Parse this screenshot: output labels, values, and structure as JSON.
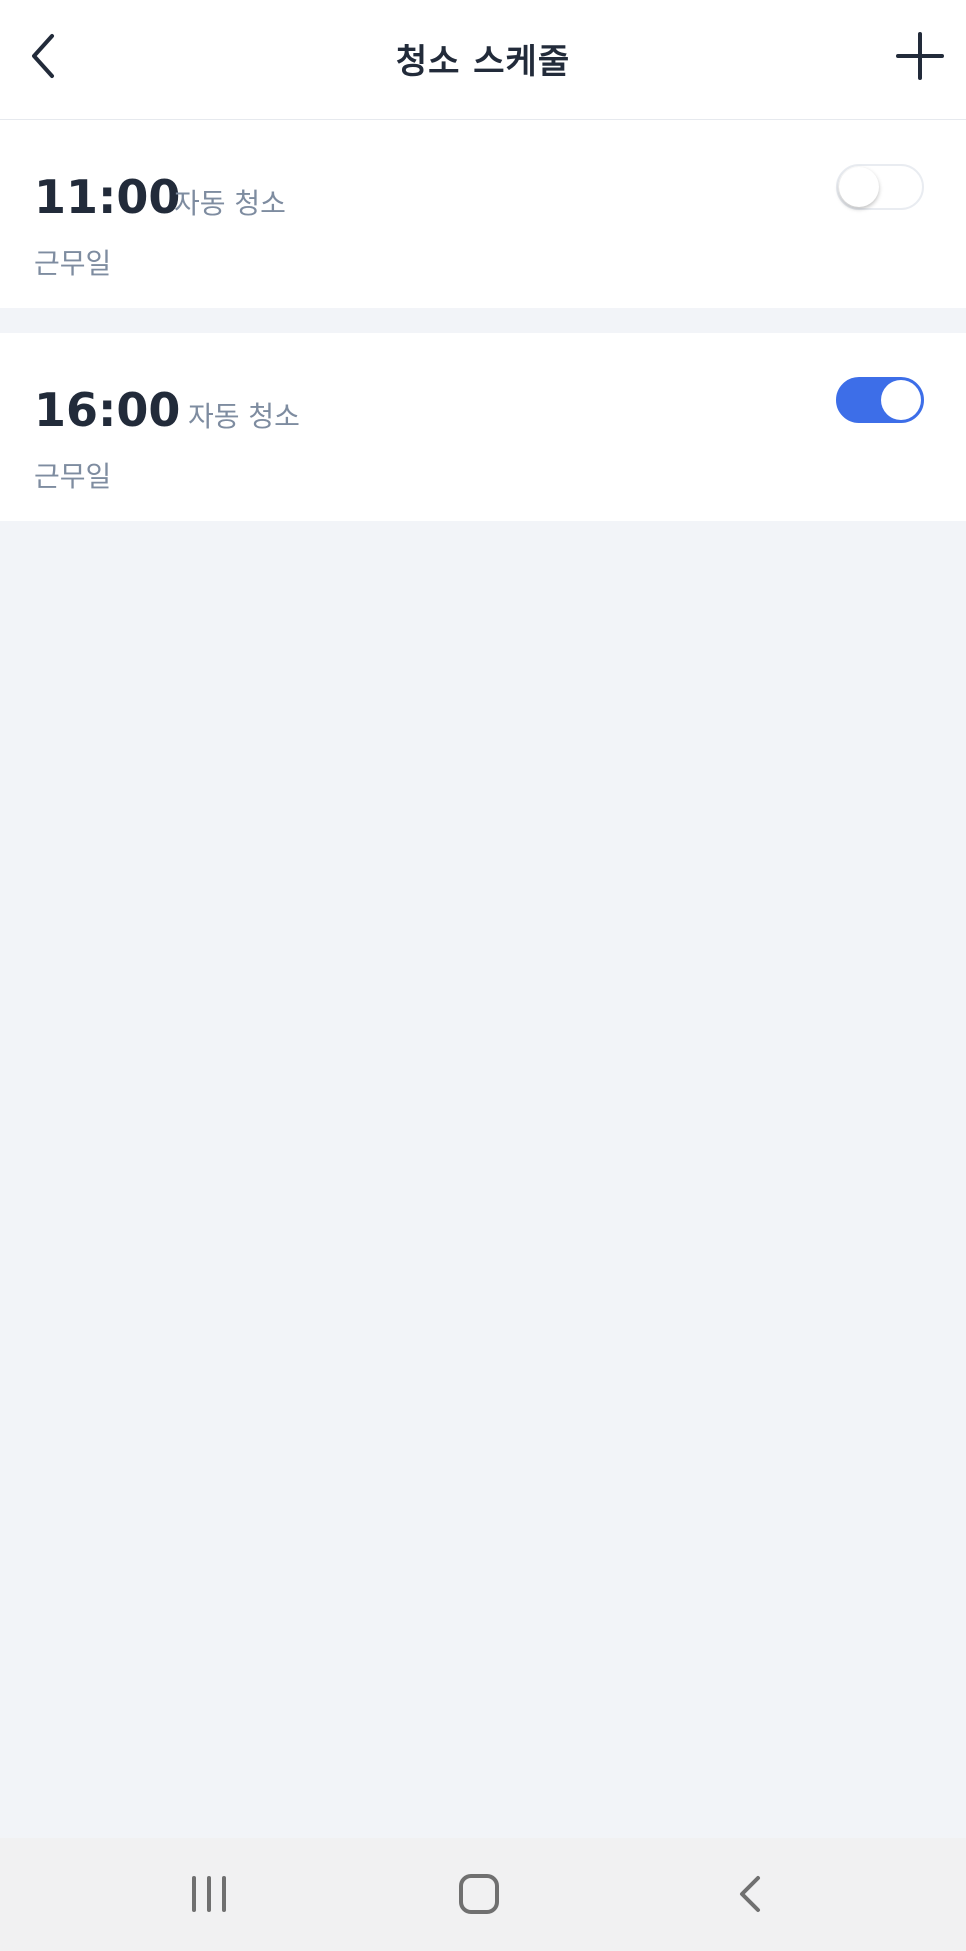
{
  "header": {
    "title": "청소 스케줄",
    "back_icon": "chevron-left-icon",
    "add_icon": "plus-icon"
  },
  "schedules": [
    {
      "time": "11:00",
      "mode": "자동 청소",
      "days": "근무일",
      "enabled": false
    },
    {
      "time": "16:00",
      "mode": "자동 청소",
      "days": "근무일",
      "enabled": true
    }
  ],
  "colors": {
    "accent": "#3d6ee8",
    "background": "#f2f4f8",
    "text_primary": "#222b3a",
    "text_secondary": "#7e8ca0"
  },
  "system_nav": {
    "recents_icon": "recent-apps-icon",
    "home_icon": "home-icon",
    "back_icon": "back-icon"
  }
}
